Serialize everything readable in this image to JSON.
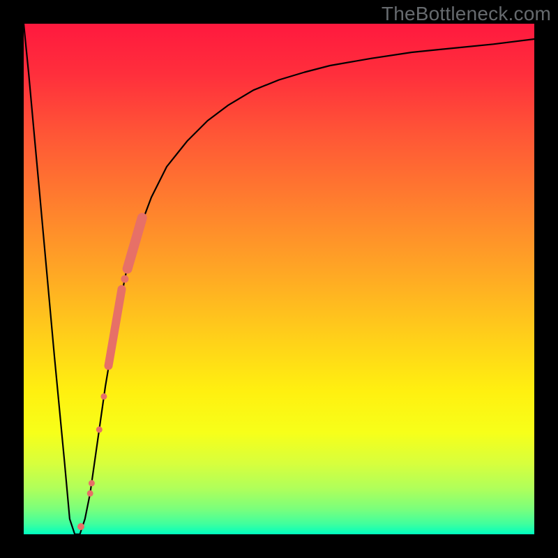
{
  "watermark": {
    "text": "TheBottleneck.com"
  },
  "gradient": {
    "stops": [
      {
        "offset": 0.0,
        "color": "#ff193e"
      },
      {
        "offset": 0.1,
        "color": "#ff2f3c"
      },
      {
        "offset": 0.22,
        "color": "#ff5736"
      },
      {
        "offset": 0.35,
        "color": "#ff7e2e"
      },
      {
        "offset": 0.48,
        "color": "#ffa525"
      },
      {
        "offset": 0.6,
        "color": "#ffcb1b"
      },
      {
        "offset": 0.72,
        "color": "#fff010"
      },
      {
        "offset": 0.8,
        "color": "#f7ff19"
      },
      {
        "offset": 0.86,
        "color": "#d8ff3c"
      },
      {
        "offset": 0.91,
        "color": "#b0ff5a"
      },
      {
        "offset": 0.95,
        "color": "#7bff7b"
      },
      {
        "offset": 0.98,
        "color": "#3fff9e"
      },
      {
        "offset": 1.0,
        "color": "#00ffc0"
      }
    ]
  },
  "chart_data": {
    "type": "line",
    "title": "",
    "xlabel": "",
    "ylabel": "",
    "xlim": [
      0,
      100
    ],
    "ylim": [
      0,
      100
    ],
    "series": [
      {
        "name": "curve",
        "x": [
          0,
          1,
          2,
          3,
          4,
          5,
          6,
          8,
          9,
          10,
          11,
          12,
          13,
          14,
          16,
          18,
          20,
          22,
          25,
          28,
          32,
          36,
          40,
          45,
          50,
          55,
          60,
          68,
          76,
          84,
          92,
          100
        ],
        "y": [
          100,
          90,
          79,
          68,
          57,
          46,
          35,
          14,
          3,
          0,
          0,
          3,
          8,
          15,
          29,
          41,
          51,
          58,
          66,
          72,
          77,
          81,
          84,
          87,
          89,
          90.5,
          91.8,
          93.2,
          94.4,
          95.2,
          96,
          97
        ]
      }
    ],
    "markers": [
      {
        "name": "dot",
        "x": 13.3,
        "y": 10,
        "r": 4.5
      },
      {
        "name": "dot",
        "x": 14.8,
        "y": 20.5,
        "r": 4.5
      },
      {
        "name": "dot",
        "x": 15.7,
        "y": 27,
        "r": 4.5
      },
      {
        "name": "bar",
        "x1": 16.6,
        "y1": 33,
        "x2": 19.2,
        "y2": 48,
        "w": 12
      },
      {
        "name": "dot",
        "x": 19.8,
        "y": 50,
        "r": 5.5
      },
      {
        "name": "bar",
        "x1": 20.3,
        "y1": 52,
        "x2": 23.2,
        "y2": 62,
        "w": 14
      },
      {
        "name": "dot",
        "x": 13.0,
        "y": 8,
        "r": 4.5
      },
      {
        "name": "dot",
        "x": 11.2,
        "y": 1.5,
        "r": 5.0
      }
    ],
    "marker_color": "#e77067"
  }
}
